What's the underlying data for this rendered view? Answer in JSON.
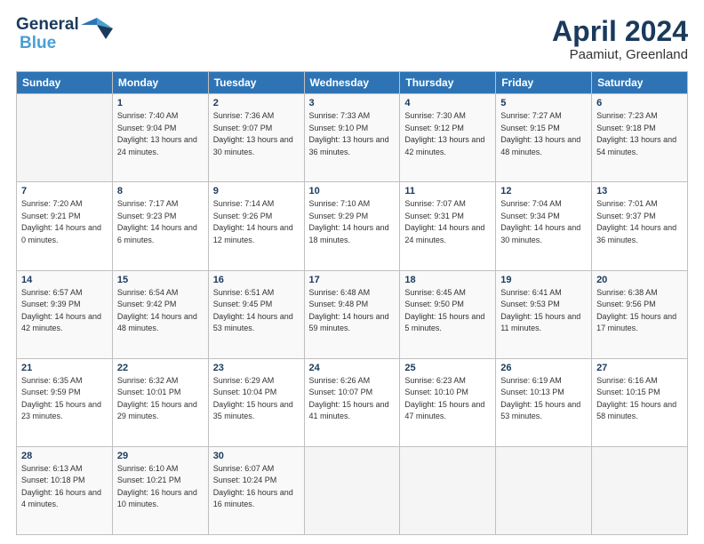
{
  "header": {
    "logo_line1": "General",
    "logo_line2": "Blue",
    "month": "April 2024",
    "location": "Paamiut, Greenland"
  },
  "weekdays": [
    "Sunday",
    "Monday",
    "Tuesday",
    "Wednesday",
    "Thursday",
    "Friday",
    "Saturday"
  ],
  "weeks": [
    [
      {
        "day": "",
        "sunrise": "",
        "sunset": "",
        "daylight": ""
      },
      {
        "day": "1",
        "sunrise": "Sunrise: 7:40 AM",
        "sunset": "Sunset: 9:04 PM",
        "daylight": "Daylight: 13 hours and 24 minutes."
      },
      {
        "day": "2",
        "sunrise": "Sunrise: 7:36 AM",
        "sunset": "Sunset: 9:07 PM",
        "daylight": "Daylight: 13 hours and 30 minutes."
      },
      {
        "day": "3",
        "sunrise": "Sunrise: 7:33 AM",
        "sunset": "Sunset: 9:10 PM",
        "daylight": "Daylight: 13 hours and 36 minutes."
      },
      {
        "day": "4",
        "sunrise": "Sunrise: 7:30 AM",
        "sunset": "Sunset: 9:12 PM",
        "daylight": "Daylight: 13 hours and 42 minutes."
      },
      {
        "day": "5",
        "sunrise": "Sunrise: 7:27 AM",
        "sunset": "Sunset: 9:15 PM",
        "daylight": "Daylight: 13 hours and 48 minutes."
      },
      {
        "day": "6",
        "sunrise": "Sunrise: 7:23 AM",
        "sunset": "Sunset: 9:18 PM",
        "daylight": "Daylight: 13 hours and 54 minutes."
      }
    ],
    [
      {
        "day": "7",
        "sunrise": "Sunrise: 7:20 AM",
        "sunset": "Sunset: 9:21 PM",
        "daylight": "Daylight: 14 hours and 0 minutes."
      },
      {
        "day": "8",
        "sunrise": "Sunrise: 7:17 AM",
        "sunset": "Sunset: 9:23 PM",
        "daylight": "Daylight: 14 hours and 6 minutes."
      },
      {
        "day": "9",
        "sunrise": "Sunrise: 7:14 AM",
        "sunset": "Sunset: 9:26 PM",
        "daylight": "Daylight: 14 hours and 12 minutes."
      },
      {
        "day": "10",
        "sunrise": "Sunrise: 7:10 AM",
        "sunset": "Sunset: 9:29 PM",
        "daylight": "Daylight: 14 hours and 18 minutes."
      },
      {
        "day": "11",
        "sunrise": "Sunrise: 7:07 AM",
        "sunset": "Sunset: 9:31 PM",
        "daylight": "Daylight: 14 hours and 24 minutes."
      },
      {
        "day": "12",
        "sunrise": "Sunrise: 7:04 AM",
        "sunset": "Sunset: 9:34 PM",
        "daylight": "Daylight: 14 hours and 30 minutes."
      },
      {
        "day": "13",
        "sunrise": "Sunrise: 7:01 AM",
        "sunset": "Sunset: 9:37 PM",
        "daylight": "Daylight: 14 hours and 36 minutes."
      }
    ],
    [
      {
        "day": "14",
        "sunrise": "Sunrise: 6:57 AM",
        "sunset": "Sunset: 9:39 PM",
        "daylight": "Daylight: 14 hours and 42 minutes."
      },
      {
        "day": "15",
        "sunrise": "Sunrise: 6:54 AM",
        "sunset": "Sunset: 9:42 PM",
        "daylight": "Daylight: 14 hours and 48 minutes."
      },
      {
        "day": "16",
        "sunrise": "Sunrise: 6:51 AM",
        "sunset": "Sunset: 9:45 PM",
        "daylight": "Daylight: 14 hours and 53 minutes."
      },
      {
        "day": "17",
        "sunrise": "Sunrise: 6:48 AM",
        "sunset": "Sunset: 9:48 PM",
        "daylight": "Daylight: 14 hours and 59 minutes."
      },
      {
        "day": "18",
        "sunrise": "Sunrise: 6:45 AM",
        "sunset": "Sunset: 9:50 PM",
        "daylight": "Daylight: 15 hours and 5 minutes."
      },
      {
        "day": "19",
        "sunrise": "Sunrise: 6:41 AM",
        "sunset": "Sunset: 9:53 PM",
        "daylight": "Daylight: 15 hours and 11 minutes."
      },
      {
        "day": "20",
        "sunrise": "Sunrise: 6:38 AM",
        "sunset": "Sunset: 9:56 PM",
        "daylight": "Daylight: 15 hours and 17 minutes."
      }
    ],
    [
      {
        "day": "21",
        "sunrise": "Sunrise: 6:35 AM",
        "sunset": "Sunset: 9:59 PM",
        "daylight": "Daylight: 15 hours and 23 minutes."
      },
      {
        "day": "22",
        "sunrise": "Sunrise: 6:32 AM",
        "sunset": "Sunset: 10:01 PM",
        "daylight": "Daylight: 15 hours and 29 minutes."
      },
      {
        "day": "23",
        "sunrise": "Sunrise: 6:29 AM",
        "sunset": "Sunset: 10:04 PM",
        "daylight": "Daylight: 15 hours and 35 minutes."
      },
      {
        "day": "24",
        "sunrise": "Sunrise: 6:26 AM",
        "sunset": "Sunset: 10:07 PM",
        "daylight": "Daylight: 15 hours and 41 minutes."
      },
      {
        "day": "25",
        "sunrise": "Sunrise: 6:23 AM",
        "sunset": "Sunset: 10:10 PM",
        "daylight": "Daylight: 15 hours and 47 minutes."
      },
      {
        "day": "26",
        "sunrise": "Sunrise: 6:19 AM",
        "sunset": "Sunset: 10:13 PM",
        "daylight": "Daylight: 15 hours and 53 minutes."
      },
      {
        "day": "27",
        "sunrise": "Sunrise: 6:16 AM",
        "sunset": "Sunset: 10:15 PM",
        "daylight": "Daylight: 15 hours and 58 minutes."
      }
    ],
    [
      {
        "day": "28",
        "sunrise": "Sunrise: 6:13 AM",
        "sunset": "Sunset: 10:18 PM",
        "daylight": "Daylight: 16 hours and 4 minutes."
      },
      {
        "day": "29",
        "sunrise": "Sunrise: 6:10 AM",
        "sunset": "Sunset: 10:21 PM",
        "daylight": "Daylight: 16 hours and 10 minutes."
      },
      {
        "day": "30",
        "sunrise": "Sunrise: 6:07 AM",
        "sunset": "Sunset: 10:24 PM",
        "daylight": "Daylight: 16 hours and 16 minutes."
      },
      {
        "day": "",
        "sunrise": "",
        "sunset": "",
        "daylight": ""
      },
      {
        "day": "",
        "sunrise": "",
        "sunset": "",
        "daylight": ""
      },
      {
        "day": "",
        "sunrise": "",
        "sunset": "",
        "daylight": ""
      },
      {
        "day": "",
        "sunrise": "",
        "sunset": "",
        "daylight": ""
      }
    ]
  ]
}
